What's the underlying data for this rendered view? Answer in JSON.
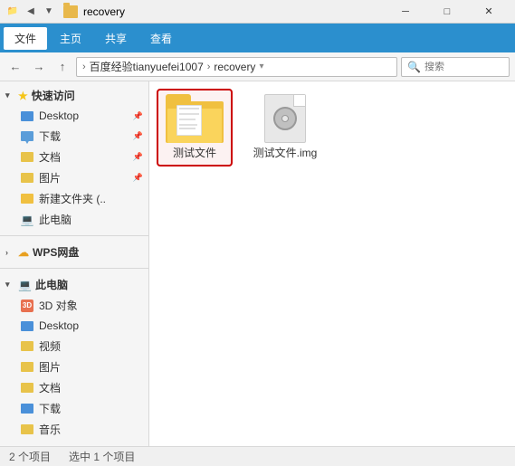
{
  "titlebar": {
    "title": "recovery",
    "controls": {
      "minimize": "─",
      "maximize": "□",
      "close": "✕"
    }
  },
  "ribbon": {
    "tabs": [
      "文件",
      "主页",
      "共享",
      "查看"
    ]
  },
  "navbar": {
    "back_disabled": false,
    "forward_disabled": false,
    "up_disabled": false,
    "address": {
      "root": "百度经验tianyuefei1007",
      "current": "recovery"
    },
    "search_placeholder": "搜索"
  },
  "sidebar": {
    "quick_access_label": "快速访问",
    "items_quick": [
      {
        "label": "Desktop",
        "icon": "desktop",
        "pinned": true
      },
      {
        "label": "下载",
        "icon": "download",
        "pinned": true
      },
      {
        "label": "文档",
        "icon": "folder",
        "pinned": true
      },
      {
        "label": "图片",
        "icon": "folder-img",
        "pinned": true
      },
      {
        "label": "新建文件夹 (..",
        "icon": "folder-new",
        "pinned": false
      },
      {
        "label": "此电脑",
        "icon": "pc",
        "pinned": false
      }
    ],
    "wps_label": "WPS网盘",
    "this_pc_label": "此电脑",
    "this_pc_items": [
      {
        "label": "3D 对象",
        "icon": "3d"
      },
      {
        "label": "Desktop",
        "icon": "desktop"
      },
      {
        "label": "视频",
        "icon": "video"
      },
      {
        "label": "图片",
        "icon": "picture"
      },
      {
        "label": "文档",
        "icon": "doc"
      },
      {
        "label": "下载",
        "icon": "download-blue"
      },
      {
        "label": "音乐",
        "icon": "music"
      }
    ]
  },
  "content": {
    "items": [
      {
        "name": "测试文件",
        "type": "folder",
        "selected": true
      },
      {
        "name": "测试文件.img",
        "type": "img",
        "selected": false
      }
    ]
  },
  "statusbar": {
    "count": "2 个项目",
    "selected": "选中 1 个项目"
  }
}
